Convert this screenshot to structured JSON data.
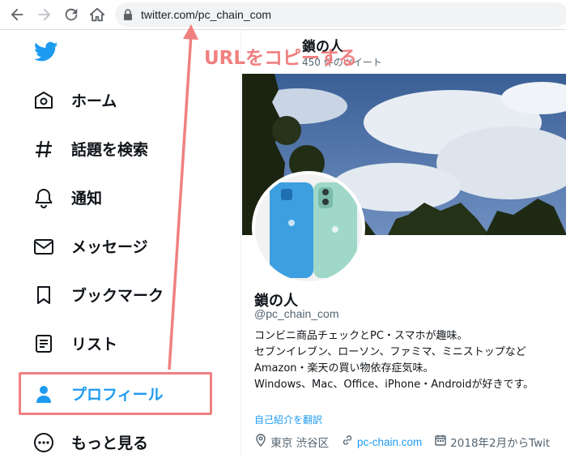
{
  "browser": {
    "url": "twitter.com/pc_chain_com",
    "icons": [
      "back-arrow-icon",
      "forward-arrow-icon",
      "reload-icon",
      "home-icon",
      "lock-icon"
    ]
  },
  "sidebar": {
    "logo": "twitter-bird-icon",
    "items": [
      {
        "label": "ホーム",
        "icon": "home-icon"
      },
      {
        "label": "話題を検索",
        "icon": "hashtag-icon"
      },
      {
        "label": "通知",
        "icon": "bell-icon"
      },
      {
        "label": "メッセージ",
        "icon": "envelope-icon"
      },
      {
        "label": "ブックマーク",
        "icon": "bookmark-icon"
      },
      {
        "label": "リスト",
        "icon": "list-icon"
      },
      {
        "label": "プロフィール",
        "icon": "person-icon",
        "active": true
      },
      {
        "label": "もっと見る",
        "icon": "more-circle-icon"
      }
    ]
  },
  "profile": {
    "header_name": "鎖の人",
    "header_count": "4",
    "header_count_suffix": "50 件のツイート",
    "display_name": "鎖の人",
    "handle": "@pc_chain_com",
    "bio": [
      "コンビニ商品チェックとPC・スマホが趣味。",
      "セブンイレブン、ローソン、ファミマ、ミニストップなど",
      "Amazon・楽天の買い物依存症気味。",
      "Windows、Mac、Office、iPhone・Androidが好きです。"
    ],
    "translate_label": "自己紹介を翻訳",
    "location": "東京 渋谷区",
    "website": "pc-chain.com",
    "joined": "2018年2月からTwit"
  },
  "annotation": {
    "text": "URLをコピーする",
    "color": "#f08080"
  },
  "colors": {
    "accent": "#1d9bf0",
    "annotation": "#f08080"
  }
}
